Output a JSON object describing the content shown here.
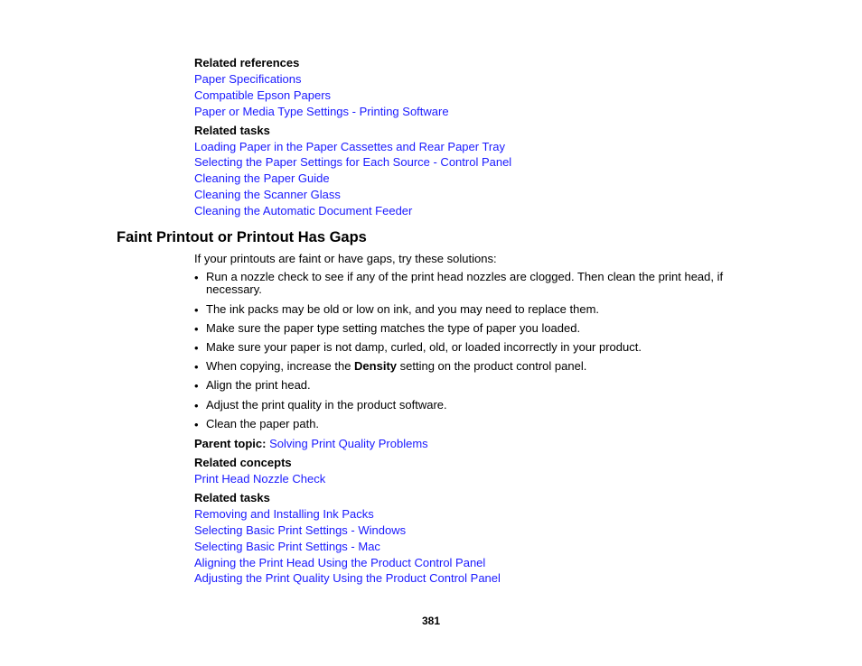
{
  "top_section": {
    "related_references_label": "Related references",
    "related_references": [
      "Paper Specifications",
      "Compatible Epson Papers",
      "Paper or Media Type Settings - Printing Software"
    ],
    "related_tasks_label": "Related tasks",
    "related_tasks": [
      "Loading Paper in the Paper Cassettes and Rear Paper Tray",
      "Selecting the Paper Settings for Each Source - Control Panel",
      "Cleaning the Paper Guide",
      "Cleaning the Scanner Glass",
      "Cleaning the Automatic Document Feeder"
    ]
  },
  "section": {
    "title": "Faint Printout or Printout Has Gaps",
    "intro": "If your printouts are faint or have gaps, try these solutions:",
    "bullet_glyph": "•",
    "bullets": [
      {
        "line1": "Run a nozzle check to see if any of the print head nozzles are clogged. Then clean the print head, if",
        "line2": "necessary."
      },
      {
        "text": "The ink packs may be old or low on ink, and you may need to replace them."
      },
      {
        "text": "Make sure the paper type setting matches the type of paper you loaded."
      },
      {
        "text": "Make sure your paper is not damp, curled, old, or loaded incorrectly in your product."
      },
      {
        "before": "When copying, increase the ",
        "bold": "Density",
        "after": " setting on the product control panel."
      },
      {
        "text": "Align the print head."
      },
      {
        "text": "Adjust the print quality in the product software."
      },
      {
        "text": "Clean the paper path."
      }
    ],
    "parent_topic_label": "Parent topic:",
    "parent_topic_link": "Solving Print Quality Problems",
    "related_concepts_label": "Related concepts",
    "related_concepts": [
      "Print Head Nozzle Check"
    ],
    "related_tasks_label": "Related tasks",
    "related_tasks": [
      "Removing and Installing Ink Packs",
      "Selecting Basic Print Settings - Windows",
      "Selecting Basic Print Settings - Mac",
      "Aligning the Print Head Using the Product Control Panel",
      "Adjusting the Print Quality Using the Product Control Panel"
    ]
  },
  "page_number": "381",
  "colors": {
    "link": "#1a1aff",
    "text": "#000000"
  }
}
